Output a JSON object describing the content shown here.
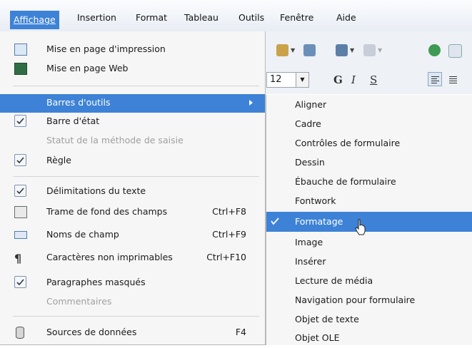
{
  "menubar": {
    "items": [
      {
        "label": "Affichage",
        "active": true
      },
      {
        "label": "Insertion"
      },
      {
        "label": "Format"
      },
      {
        "label": "Tableau"
      },
      {
        "label": "Outils"
      },
      {
        "label": "Fenêtre"
      },
      {
        "label": "Aide"
      }
    ]
  },
  "toolbar": {
    "font_size": "12",
    "bold": "G",
    "italic": "I",
    "shadow": "S"
  },
  "view_menu": {
    "items": [
      {
        "label": "Mise en page d'impression",
        "icon": "print-layout-icon"
      },
      {
        "label": "Mise en page Web",
        "icon": "web-layout-icon"
      },
      {
        "label": "Barres d'outils",
        "submenu": true,
        "highlighted": true
      },
      {
        "label": "Barre d'état",
        "checked": true
      },
      {
        "label": "Statut de la méthode de saisie",
        "disabled": true
      },
      {
        "label": "Règle",
        "checked": true
      },
      {
        "label": "Délimitations du texte",
        "checked": true
      },
      {
        "label": "Trame de fond des champs",
        "shortcut": "Ctrl+F8",
        "icon": "field-shading-icon"
      },
      {
        "label": "Noms de champ",
        "shortcut": "Ctrl+F9",
        "icon": "field-names-icon"
      },
      {
        "label": "Caractères non imprimables",
        "shortcut": "Ctrl+F10",
        "icon": "pilcrow-icon"
      },
      {
        "label": "Paragraphes masqués",
        "checked": true
      },
      {
        "label": "Commentaires",
        "disabled": true
      },
      {
        "label": "Sources de données",
        "shortcut": "F4",
        "icon": "data-sources-icon"
      }
    ]
  },
  "toolbars_submenu": {
    "items": [
      {
        "label": "Aligner"
      },
      {
        "label": "Cadre"
      },
      {
        "label": "Contrôles de formulaire"
      },
      {
        "label": "Dessin"
      },
      {
        "label": "Ébauche de formulaire"
      },
      {
        "label": "Fontwork"
      },
      {
        "label": "Formatage",
        "checked": true,
        "highlighted": true
      },
      {
        "label": "Image"
      },
      {
        "label": "Insérer"
      },
      {
        "label": "Lecture de média"
      },
      {
        "label": "Navigation pour formulaire"
      },
      {
        "label": "Objet de texte"
      },
      {
        "label": "Objet OLE"
      }
    ]
  }
}
